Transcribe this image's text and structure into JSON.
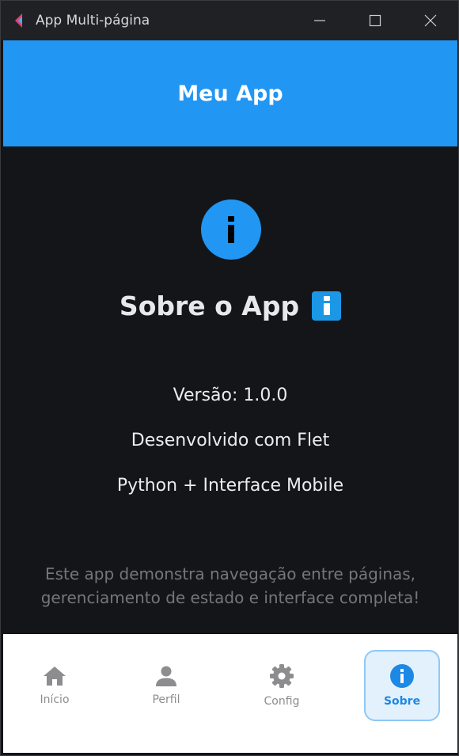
{
  "window": {
    "title": "App Multi-página"
  },
  "appbar": {
    "title": "Meu App"
  },
  "about": {
    "title": "Sobre o App",
    "lines": [
      "Versão: 1.0.0",
      "Desenvolvido com Flet",
      "Python + Interface Mobile"
    ],
    "description": "Este app demonstra navegação entre páginas, gerenciamento de estado e interface completa!"
  },
  "nav": {
    "items": [
      {
        "label": "Início",
        "icon": "home-icon"
      },
      {
        "label": "Perfil",
        "icon": "person-icon"
      },
      {
        "label": "Config",
        "icon": "gear-icon"
      },
      {
        "label": "Sobre",
        "icon": "info-icon"
      }
    ],
    "active": "Sobre"
  },
  "colors": {
    "primary": "#2196f3",
    "background": "#141518",
    "nav_active_bg": "#e3f1fd",
    "nav_inactive": "#8d8d8f"
  }
}
